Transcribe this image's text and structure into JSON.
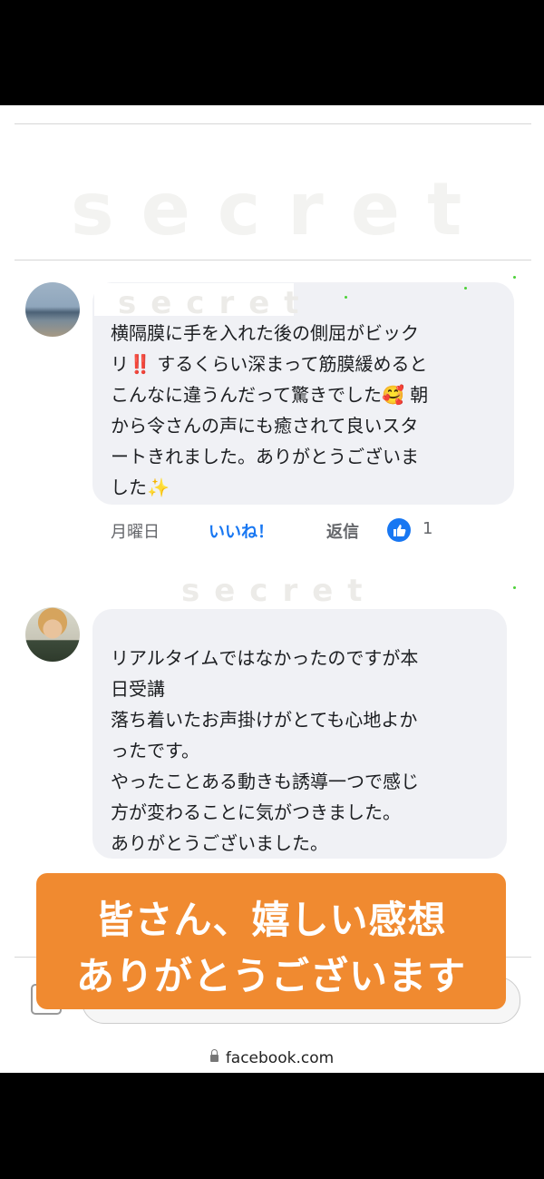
{
  "watermark": "secret",
  "comments": [
    {
      "text": "横隔膜に手を入れた後の側屈がビック\nリ‼️ するくらい深まって筋膜緩めると\nこんなに違うんだって驚きでした🥰 朝\nから令さんの声にも癒されて良いスタ\nートきれました。ありがとうございま\nした✨",
      "day": "月曜日",
      "like_label": "いいね！",
      "reply_label": "返信",
      "likes": "1"
    },
    {
      "text": "リアルタイムではなかったのですが本\n日受講\n落ち着いたお声掛けがとても心地よか\nったです。\nやったことある動きも誘導一つで感じ\n方が変わることに気がつきました。\nありがとうございました。"
    }
  ],
  "banner": {
    "line1": "皆さん、嬉しい感想",
    "line2": "ありがとうございます",
    "color": "#f08a30"
  },
  "url": "facebook.com"
}
